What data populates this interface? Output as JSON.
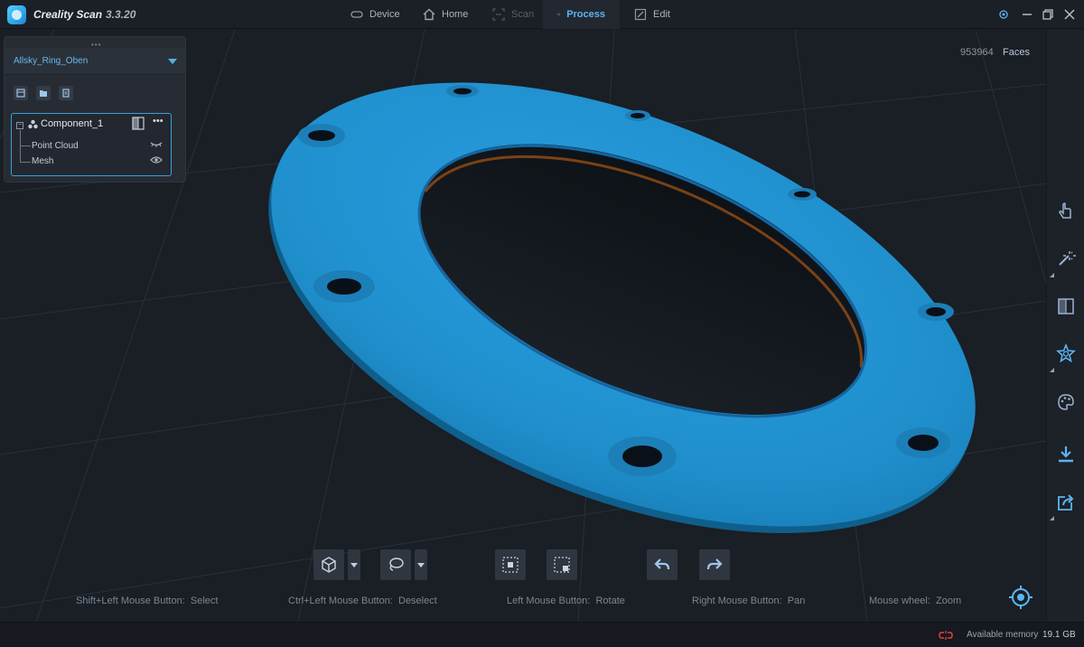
{
  "app": {
    "name": "Creality Scan",
    "version": "3.3.20"
  },
  "nav": {
    "tabs": [
      {
        "label": "Device",
        "state": "normal"
      },
      {
        "label": "Home",
        "state": "normal"
      },
      {
        "label": "Scan",
        "state": "disabled"
      },
      {
        "label": "Process",
        "state": "active"
      },
      {
        "label": "Edit",
        "state": "normal"
      }
    ]
  },
  "project_panel": {
    "project_name": "Allsky_Ring_Oben",
    "component": "Component_1",
    "children": [
      "Point Cloud",
      "Mesh"
    ]
  },
  "viewport": {
    "face_count": "953964",
    "face_label": "Faces",
    "model_color": "#1f8fcc"
  },
  "hints": [
    {
      "key": "Shift+Left Mouse Button:",
      "action": "Select"
    },
    {
      "key": "Ctrl+Left Mouse Button:",
      "action": "Deselect"
    },
    {
      "key": "Left Mouse Button:",
      "action": "Rotate"
    },
    {
      "key": "Right Mouse Button:",
      "action": "Pan"
    },
    {
      "key": "Mouse wheel:",
      "action": "Zoom"
    }
  ],
  "status": {
    "memory_label": "Available memory",
    "memory_value": "19.1 GB"
  },
  "colors": {
    "accent": "#5bb4f2",
    "background": "#1a1e25",
    "panel": "#272c34"
  }
}
